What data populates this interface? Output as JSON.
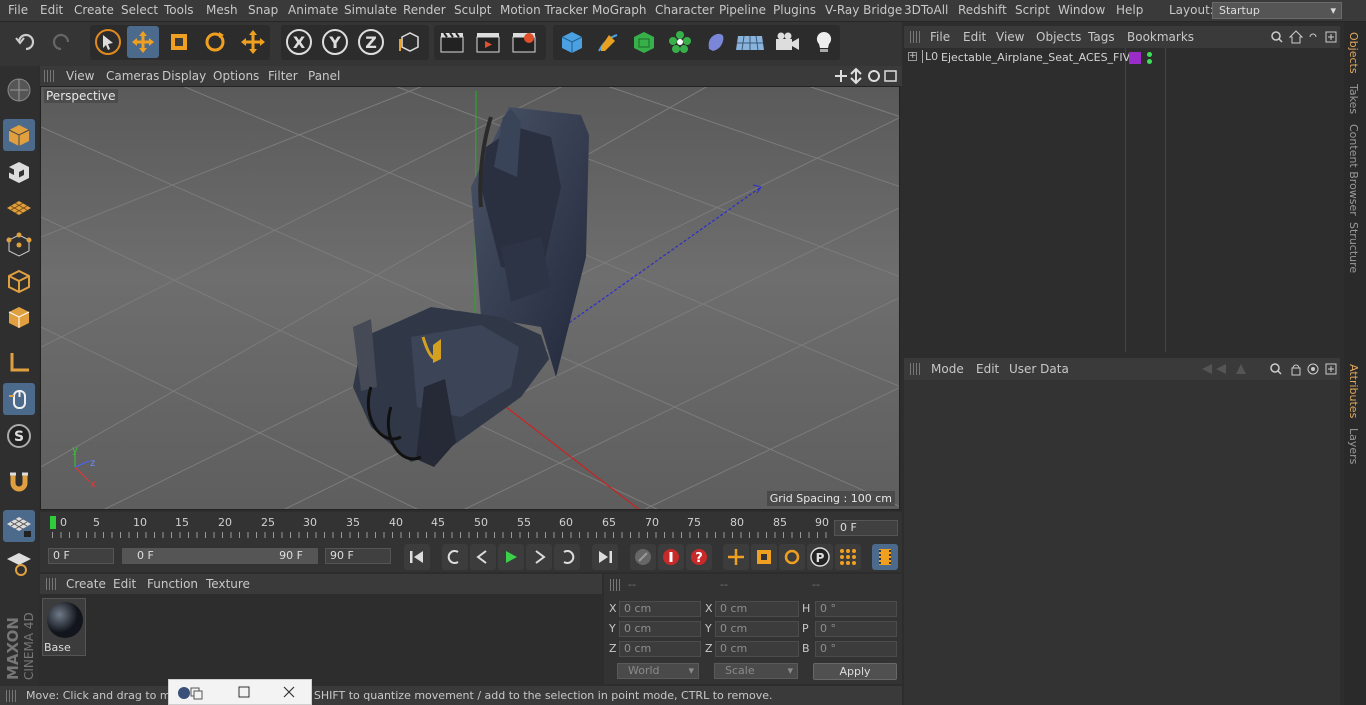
{
  "menubar": {
    "items": [
      "File",
      "Edit",
      "Create",
      "Select",
      "Tools",
      "Mesh",
      "Snap",
      "Animate",
      "Simulate",
      "Render",
      "Sculpt",
      "Motion Tracker",
      "MoGraph",
      "Character",
      "Pipeline",
      "Plugins",
      "V-Ray Bridge",
      "3DToAll",
      "Redshift",
      "Script",
      "Window",
      "Help"
    ],
    "layout_label": "Layout:",
    "layout_value": "Startup"
  },
  "viewport": {
    "menu": [
      "View",
      "Cameras",
      "Display",
      "Options",
      "Filter",
      "Panel"
    ],
    "label": "Perspective",
    "grid_spacing": "Grid Spacing : 100 cm",
    "axis_labels": {
      "y": "y",
      "z": "z",
      "x": "x"
    }
  },
  "timeline": {
    "ticks": [
      "0",
      "5",
      "10",
      "15",
      "20",
      "25",
      "30",
      "35",
      "40",
      "45",
      "50",
      "55",
      "60",
      "65",
      "70",
      "75",
      "80",
      "85",
      "90"
    ],
    "current_frame": "0 F"
  },
  "transport": {
    "start_field": "0 F",
    "range_start": "0 F",
    "range_end": "90 F",
    "end_field": "90 F"
  },
  "material": {
    "menu": [
      "Create",
      "Edit",
      "Function",
      "Texture"
    ],
    "swatch_label": "Base"
  },
  "coords": {
    "headers": [
      "--",
      "--",
      "--"
    ],
    "rows": [
      {
        "l1": "X",
        "v1": "0 cm",
        "l2": "X",
        "v2": "0 cm",
        "l3": "H",
        "v3": "0 °"
      },
      {
        "l1": "Y",
        "v1": "0 cm",
        "l2": "Y",
        "v2": "0 cm",
        "l3": "P",
        "v3": "0 °"
      },
      {
        "l1": "Z",
        "v1": "0 cm",
        "l2": "Z",
        "v2": "0 cm",
        "l3": "B",
        "v3": "0 °"
      }
    ],
    "world": "World",
    "scale": "Scale",
    "apply": "Apply"
  },
  "status": {
    "text": "Move: Click and drag to move elements. Hold down SHIFT to quantize movement / add to the selection in point mode, CTRL to remove."
  },
  "objects": {
    "menu": [
      "File",
      "Edit",
      "View",
      "Objects",
      "Tags",
      "Bookmarks"
    ],
    "tree": [
      {
        "name": "Ejectable_Airplane_Seat_ACES_FIVE",
        "layer": "L0"
      }
    ]
  },
  "attributes": {
    "menu": [
      "Mode",
      "Edit",
      "User Data"
    ]
  },
  "right_tabs": [
    "Objects",
    "Takes",
    "Content Browser",
    "Structure",
    "Attributes",
    "Layers"
  ],
  "brand": {
    "maxon": "MAXON",
    "cinema": "CINEMA 4D"
  },
  "colors": {
    "accent": "#4c6a8c",
    "tab_active": "#e0a85c",
    "play": "#3bd24a"
  }
}
